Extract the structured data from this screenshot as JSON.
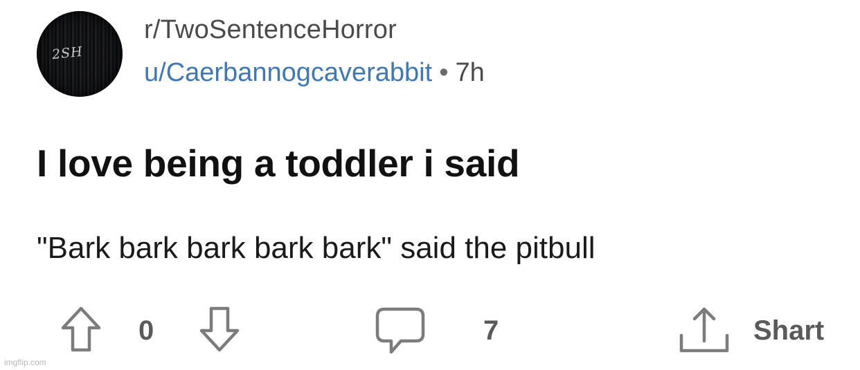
{
  "post": {
    "subreddit": "r/TwoSentenceHorror",
    "username": "u/Caerbannogcaverabbit",
    "separator": "•",
    "age": "7h",
    "avatar_text": "2SH",
    "title": "I love being a toddler i said",
    "body": "\"Bark bark bark bark bark\" said the pitbull"
  },
  "actions": {
    "vote_count": "0",
    "comment_count": "7",
    "share_label": "Shart"
  },
  "icons": {
    "upvote": "arrow-up-outline-icon",
    "downvote": "arrow-down-outline-icon",
    "comment": "speech-bubble-icon",
    "share": "share-upload-icon"
  },
  "watermark": "imgflip.com",
  "colors": {
    "username": "#3e79b5",
    "text": "#1a1a1b",
    "muted": "#5a5a5b",
    "icon": "#7c7c7c"
  }
}
